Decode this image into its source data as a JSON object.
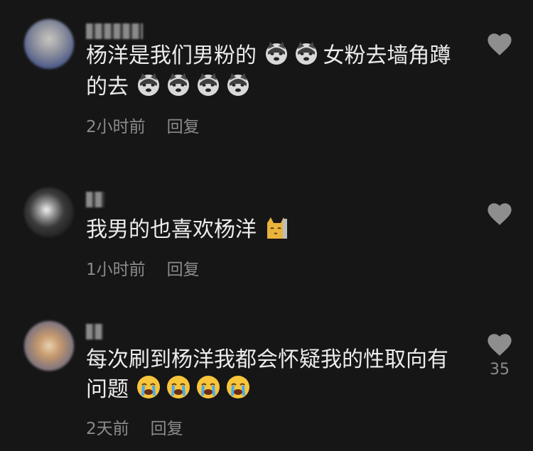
{
  "comments": [
    {
      "lines": [
        "杨洋是我们男粉的",
        "女粉去墙角蹲",
        "的去"
      ],
      "line1_emojis_after": [
        "dog-emoji",
        "dog-emoji"
      ],
      "line2_emojis_after": [
        "dog-emoji",
        "dog-emoji",
        "dog-emoji",
        "dog-emoji"
      ],
      "time": "2小时前",
      "reply": "回复"
    },
    {
      "lines": [
        "我男的也喜欢杨洋"
      ],
      "emojis_after": [
        "cat-emoji"
      ],
      "time": "1小时前",
      "reply": "回复"
    },
    {
      "lines": [
        "每次刷到杨洋我都会怀疑我的性取向有",
        "问题"
      ],
      "emojis_after": [
        "crying-emoji",
        "crying-emoji",
        "crying-emoji",
        "crying-emoji"
      ],
      "time": "2天前",
      "reply": "回复",
      "likes": "35"
    }
  ],
  "icons": {
    "like": "heart-icon"
  },
  "colors": {
    "background": "#161616",
    "text": "#ececec",
    "meta": "#8b8b8b",
    "heart": "#8e8e8e"
  }
}
